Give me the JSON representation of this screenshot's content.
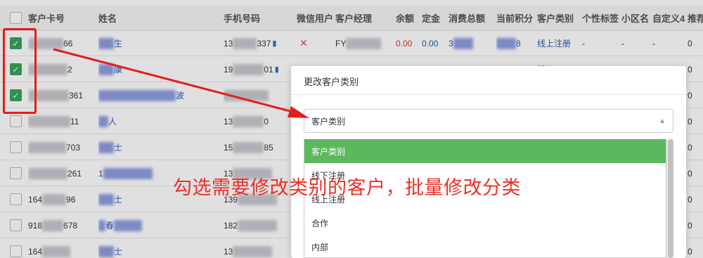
{
  "table": {
    "headers": {
      "card": "客户卡号",
      "name": "姓名",
      "phone": "手机号码",
      "wechat": "微信用户",
      "manager": "客户经理",
      "balance": "余额",
      "deposit": "定金",
      "total": "消费总额",
      "points": "当前积分",
      "type": "客户类别",
      "tag": "个性标签",
      "area": "小区名",
      "custom4": "自定义4",
      "referrer": "推荐"
    },
    "rows": [
      {
        "card_end": "66",
        "name_end": "生",
        "phone_prefix": "13",
        "phone_end": "337",
        "wechat": "✕",
        "manager_prefix": "FY",
        "balance": "0.00",
        "deposit": "0.00",
        "total_prefix": "3",
        "points_end": "8",
        "type": "线上注册",
        "tag": "-",
        "area": "-",
        "custom4": "-",
        "referrer": "0",
        "checked": true
      },
      {
        "card_end": "2",
        "name_end": "康",
        "phone_prefix": "19",
        "phone_end": "01",
        "checked": true,
        "type": "线",
        "referrer": "0"
      },
      {
        "card_end": "361",
        "name_end": "波",
        "phone_prefix": "",
        "phone_end": "",
        "checked": true,
        "referrer": "0"
      },
      {
        "card_end": "11",
        "name_end": "人",
        "phone_prefix": "13",
        "phone_end": "0",
        "checked": false,
        "referrer": "0"
      },
      {
        "card_end": "703",
        "name_end": "士",
        "phone_prefix": "15",
        "phone_end": "85",
        "checked": false,
        "referrer": "0"
      },
      {
        "card_end": "261",
        "name_end": "1",
        "phone_prefix": "13",
        "phone_end": "",
        "checked": false,
        "referrer": "0"
      },
      {
        "card_prefix": "164",
        "card_end": "96",
        "name_end": "士",
        "phone_prefix": "139",
        "phone_end": "",
        "checked": false,
        "referrer": "0"
      },
      {
        "card_prefix": "918",
        "card_end": "678",
        "name_end": "春",
        "phone_prefix": "182",
        "phone_end": "",
        "checked": false,
        "referrer": "0"
      },
      {
        "card_prefix": "164",
        "card_end": "",
        "name_end": "士",
        "phone_prefix": "13",
        "phone_end": "",
        "checked": false,
        "referrer": "0"
      }
    ]
  },
  "modal": {
    "title": "更改客户类别",
    "select_value": "客户类别",
    "options": [
      "客户类别",
      "线下注册",
      "线上注册",
      "合作",
      "内部"
    ],
    "selected_index": 0
  },
  "annotation": {
    "text": "勾选需要修改类别的客户，批量修改分类",
    "color": "#e8332a"
  },
  "colors": {
    "checked": "#3aa35b",
    "selected_option": "#5cb85c",
    "link": "#2d56b3"
  }
}
